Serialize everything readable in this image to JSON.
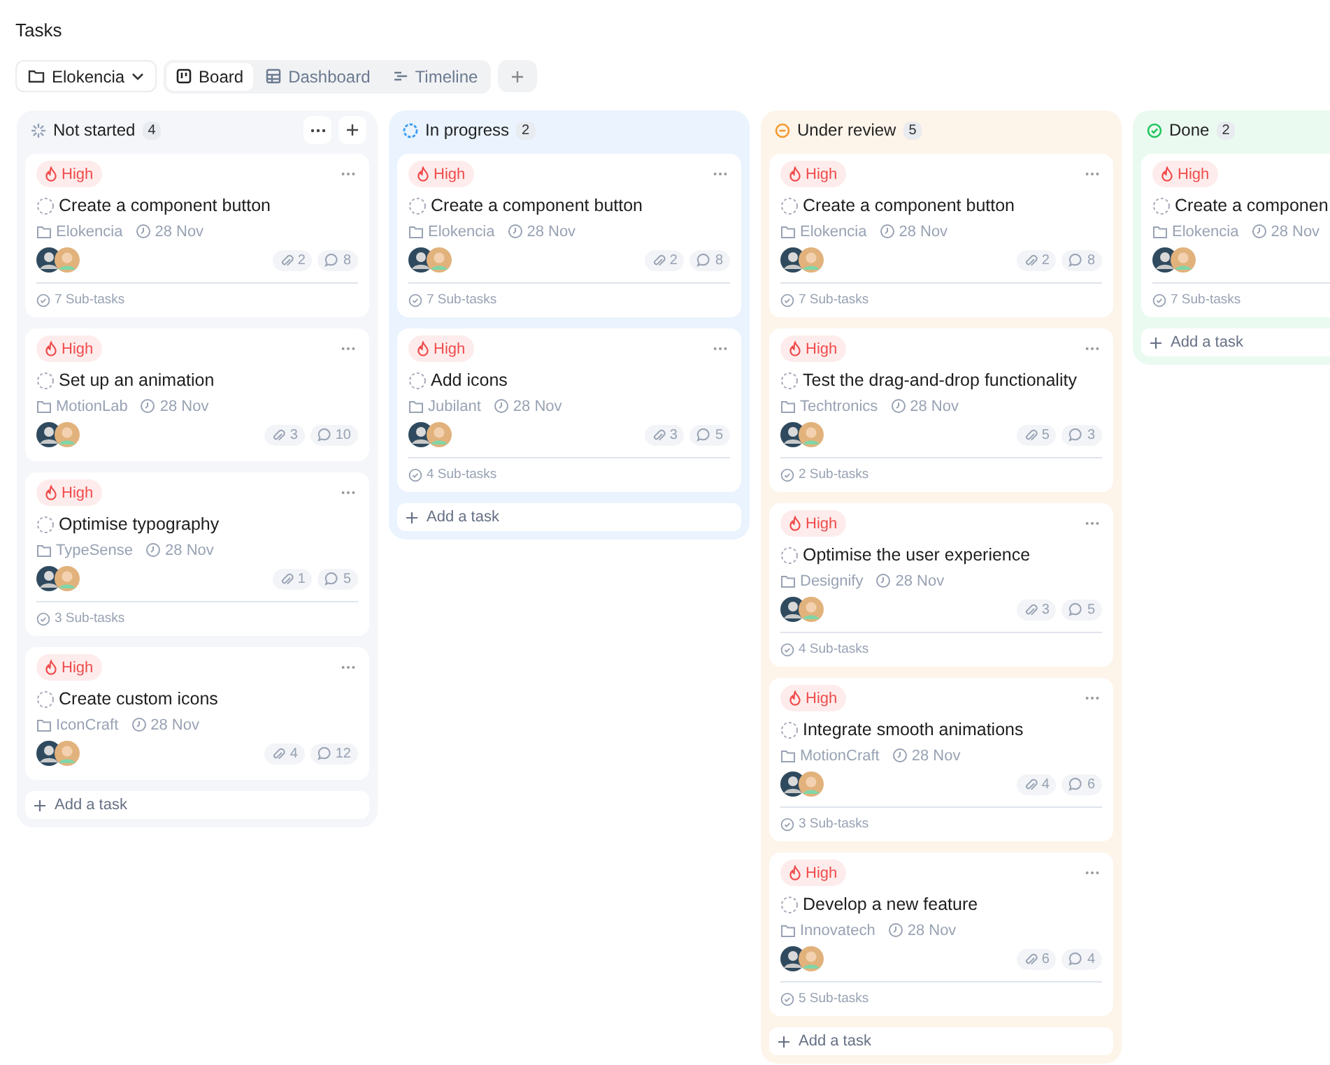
{
  "page_title": "Tasks",
  "toolbar": {
    "project": "Elokencia",
    "views": [
      {
        "label": "Board",
        "kind": "board",
        "selected": true
      },
      {
        "label": "Dashboard",
        "kind": "dashboard",
        "selected": false
      },
      {
        "label": "Timeline",
        "kind": "timeline",
        "selected": false
      }
    ]
  },
  "columns": [
    {
      "title": "Not started",
      "count": "4",
      "kind": "not_started",
      "color": "#94a3b8",
      "show_actions": true,
      "add_label": "Add a task",
      "cards": [
        {
          "priority": "High",
          "title": "Create a component button",
          "project": "Elokencia",
          "due": "28 Nov",
          "attachments": "2",
          "comments": "8",
          "subtasks": "7 Sub-tasks"
        },
        {
          "priority": "High",
          "title": "Set up an animation",
          "project": "MotionLab",
          "due": "28 Nov",
          "attachments": "3",
          "comments": "10"
        },
        {
          "priority": "High",
          "title": "Optimise typography",
          "project": "TypeSense",
          "due": "28 Nov",
          "attachments": "1",
          "comments": "5",
          "subtasks": "3 Sub-tasks"
        },
        {
          "priority": "High",
          "title": "Create custom icons",
          "project": "IconCraft",
          "due": "28 Nov",
          "attachments": "4",
          "comments": "12"
        }
      ]
    },
    {
      "title": "In progress",
      "count": "2",
      "kind": "in_progress",
      "color": "#3b9cf2",
      "show_actions": false,
      "add_label": "Add a task",
      "cards": [
        {
          "priority": "High",
          "title": "Create a component button",
          "project": "Elokencia",
          "due": "28 Nov",
          "attachments": "2",
          "comments": "8",
          "subtasks": "7 Sub-tasks"
        },
        {
          "priority": "High",
          "title": "Add icons",
          "project": "Jubilant",
          "due": "28 Nov",
          "attachments": "3",
          "comments": "5",
          "subtasks": "4 Sub-tasks"
        }
      ]
    },
    {
      "title": "Under review",
      "count": "5",
      "kind": "under_review",
      "color": "#f29a2e",
      "show_actions": false,
      "add_label": "Add a task",
      "cards": [
        {
          "priority": "High",
          "title": "Create a component button",
          "project": "Elokencia",
          "due": "28 Nov",
          "attachments": "2",
          "comments": "8",
          "subtasks": "7 Sub-tasks"
        },
        {
          "priority": "High",
          "title": "Test the drag-and-drop functionality",
          "project": "Techtronics",
          "due": "28 Nov",
          "attachments": "5",
          "comments": "3",
          "subtasks": "2 Sub-tasks"
        },
        {
          "priority": "High",
          "title": "Optimise the user experience",
          "project": "Designify",
          "due": "28 Nov",
          "attachments": "3",
          "comments": "5",
          "subtasks": "4 Sub-tasks"
        },
        {
          "priority": "High",
          "title": "Integrate smooth animations",
          "project": "MotionCraft",
          "due": "28 Nov",
          "attachments": "4",
          "comments": "6",
          "subtasks": "3 Sub-tasks"
        },
        {
          "priority": "High",
          "title": "Develop a new feature",
          "project": "Innovatech",
          "due": "28 Nov",
          "attachments": "6",
          "comments": "4",
          "subtasks": "5 Sub-tasks"
        }
      ]
    },
    {
      "title": "Done",
      "count": "2",
      "kind": "done",
      "color": "#22c55e",
      "add_label": "Add a task",
      "cards": [
        {
          "priority": "High",
          "title": "Create a componen",
          "project": "Elokencia",
          "due": "28 Nov",
          "subtasks": "7 Sub-tasks"
        }
      ]
    }
  ]
}
